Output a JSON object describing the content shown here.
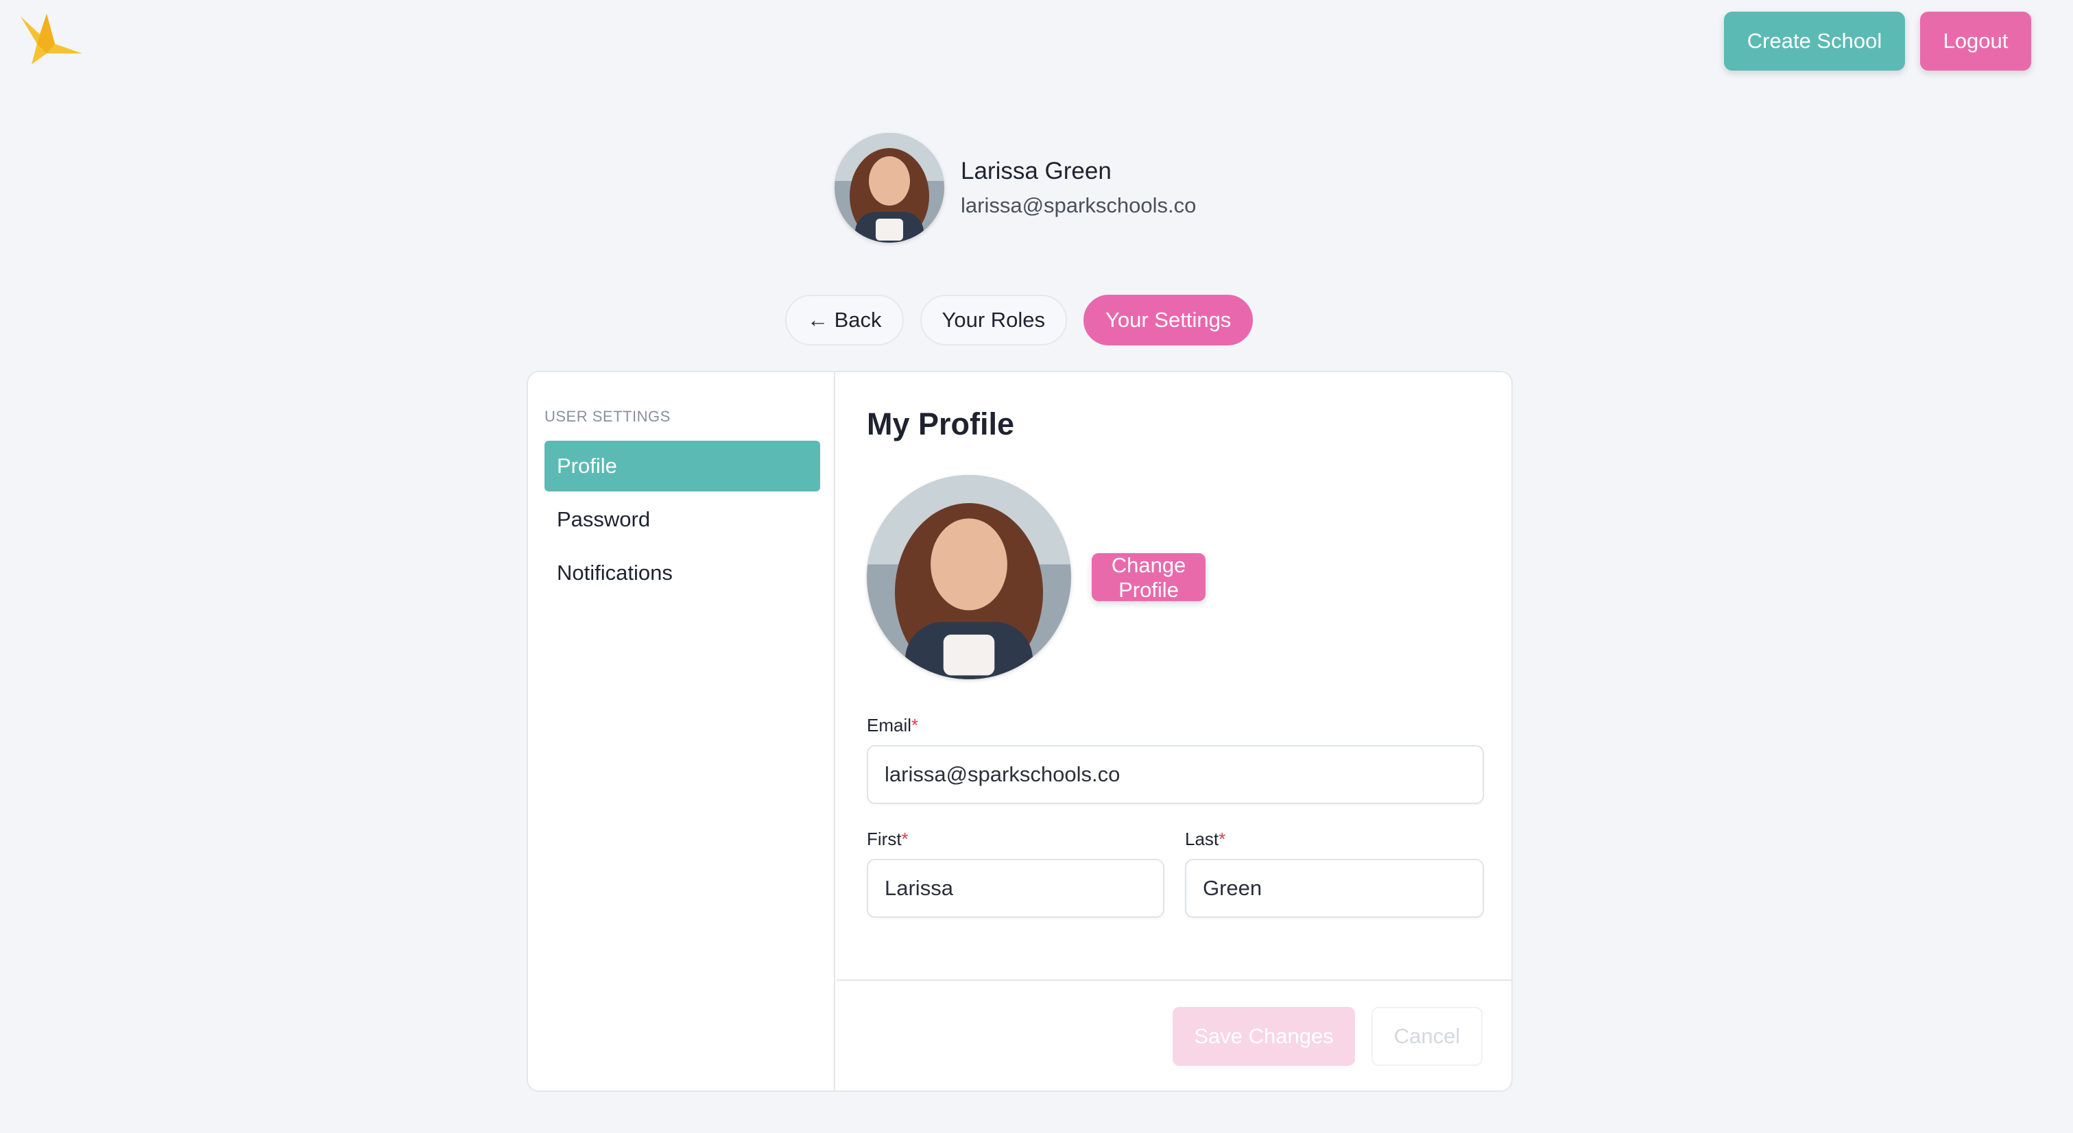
{
  "colors": {
    "teal": "#5cbab4",
    "pink": "#e96aab",
    "background": "#f4f5f9",
    "logo": "#f6c232"
  },
  "topbar": {
    "create_school_label": "Create School",
    "logout_label": "Logout"
  },
  "user": {
    "name": "Larissa Green",
    "email": "larissa@sparkschools.co"
  },
  "nav": {
    "back_label": "← Back",
    "roles_label": "Your Roles",
    "settings_label": "Your Settings",
    "active": "Your Settings"
  },
  "sidebar": {
    "section_label": "USER SETTINGS",
    "items": [
      {
        "label": "Profile",
        "active": true
      },
      {
        "label": "Password",
        "active": false
      },
      {
        "label": "Notifications",
        "active": false
      }
    ]
  },
  "profile": {
    "title": "My Profile",
    "change_picture_label": "Change Profile Picture",
    "email_label": "Email",
    "email_value": "larissa@sparkschools.co",
    "first_label": "First",
    "first_value": "Larissa",
    "last_label": "Last",
    "last_value": "Green",
    "required_marker": "*"
  },
  "footer": {
    "save_label": "Save Changes",
    "cancel_label": "Cancel"
  },
  "icons": {
    "logo": "spark-star-logo-icon"
  }
}
